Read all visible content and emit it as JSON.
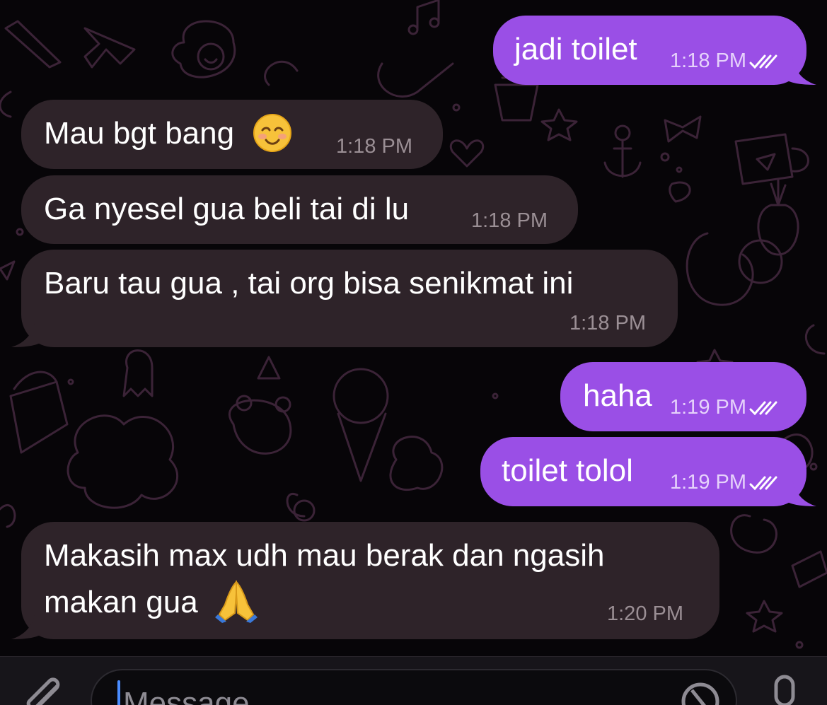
{
  "chat": {
    "messages": [
      {
        "id": "m1",
        "direction": "out",
        "text": "jadi toilet",
        "time": "1:18 PM",
        "status": "read"
      },
      {
        "id": "m2",
        "direction": "in",
        "text": "Mau bgt bang",
        "emoji": "smiling-face-emoji",
        "time": "1:18 PM"
      },
      {
        "id": "m3",
        "direction": "in",
        "text": "Ga nyesel gua beli tai di lu",
        "time": "1:18 PM"
      },
      {
        "id": "m4",
        "direction": "in",
        "text": "Baru tau gua , tai org bisa senikmat ini",
        "time": "1:18 PM"
      },
      {
        "id": "m5",
        "direction": "out",
        "text": "haha",
        "time": "1:19 PM",
        "status": "read"
      },
      {
        "id": "m6",
        "direction": "out",
        "text": "toilet tolol",
        "time": "1:19 PM",
        "status": "read"
      },
      {
        "id": "m7",
        "direction": "in",
        "line1": "Makasih max udh mau berak dan ngasih",
        "line2": "makan gua",
        "emoji": "folded-hands-emoji",
        "time": "1:20 PM"
      }
    ]
  },
  "composer": {
    "placeholder": "Message",
    "icons": [
      "paperclip-icon",
      "sticker-icon",
      "microphone-icon"
    ]
  },
  "theme": {
    "incoming_bubble": "#2e2329",
    "outgoing_bubble": "#9a4fe6",
    "background": "#070508",
    "pattern_color": "#3b2337"
  }
}
